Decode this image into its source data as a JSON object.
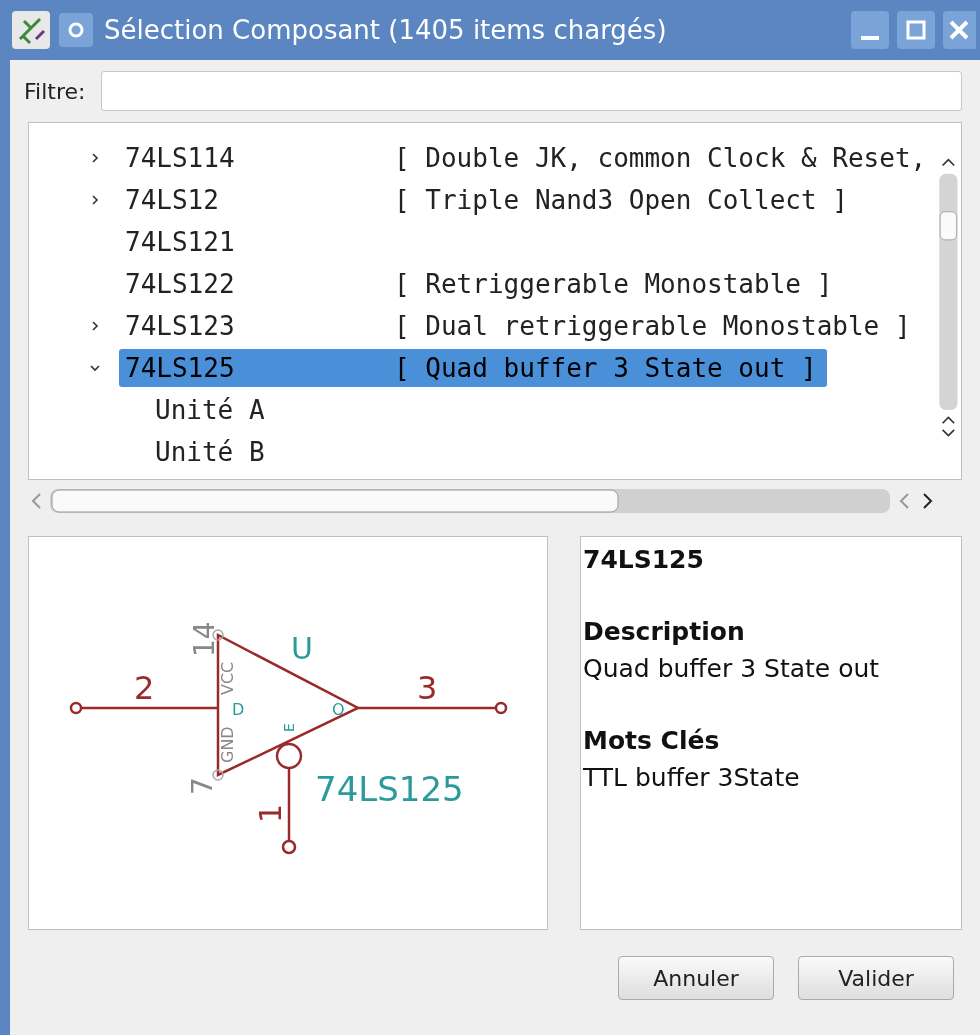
{
  "window": {
    "title": "Sélection Composant (1405 items chargés)"
  },
  "filter": {
    "label": "Filtre:"
  },
  "tree": {
    "items": [
      {
        "name": "74LS114",
        "description": "[ Double JK, common Clock & Reset,",
        "expandable": true,
        "expanded": false,
        "selected": false
      },
      {
        "name": "74LS12",
        "description": "[ Triple Nand3 Open Collect ]",
        "expandable": true,
        "expanded": false,
        "selected": false
      },
      {
        "name": "74LS121",
        "expandable": false,
        "selected": false
      },
      {
        "name": "74LS122",
        "description": "[ Retriggerable Monostable ]",
        "expandable": false,
        "selected": false
      },
      {
        "name": "74LS123",
        "description": "[ Dual retriggerable Monostable ]",
        "expandable": true,
        "expanded": false,
        "selected": false
      },
      {
        "name": "74LS125",
        "description": "[ Quad buffer 3 State out ]",
        "expandable": true,
        "expanded": true,
        "selected": true,
        "children": [
          {
            "name": "Unité A",
            "selected": false
          },
          {
            "name": "Unité B",
            "selected": false
          }
        ]
      }
    ]
  },
  "preview": {
    "reference": "U",
    "part": "74LS125",
    "pin_numbers": [
      "2",
      "3",
      "1",
      "14",
      "7"
    ],
    "pin_names": [
      "D",
      "O",
      "E",
      "VCC",
      "GND"
    ]
  },
  "info": {
    "title": "74LS125",
    "sections": [
      {
        "heading": "Description",
        "text": "Quad buffer 3 State out"
      },
      {
        "heading": "Mots Clés",
        "text": "TTL buffer 3State"
      }
    ]
  },
  "buttons": [
    {
      "label": "Annuler"
    },
    {
      "label": "Valider"
    }
  ]
}
